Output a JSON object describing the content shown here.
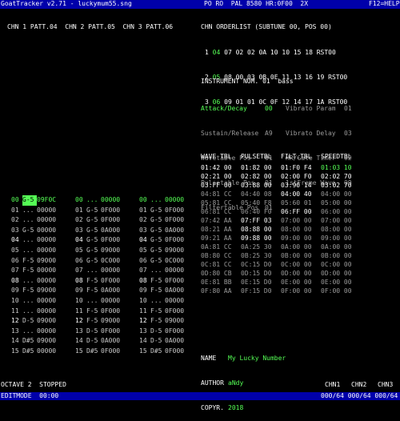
{
  "titlebar": {
    "left": "GoatTracker v2.71 - luckymum55.sng",
    "mid": "PO RO  PAL 8580 HR:0F00  2X",
    "right": "F12=HELP"
  },
  "channels_header": "CHN 1 PATT.04  CHN 2 PATT.05  CHN 3 PATT.06",
  "orderlist": {
    "title": "CHN ORDERLIST (SUBTUNE 00, POS 00)",
    "rows": [
      {
        "ch": "1",
        "first": "04",
        "rest": "07 02 02 0A 10 10 15 18 RST00"
      },
      {
        "ch": "2",
        "first": "05",
        "rest": "08 00 03 0B 0E 11 13 16 19 RST00"
      },
      {
        "ch": "3",
        "first": "06",
        "rest": "09 01 01 0C 0F 12 14 17 1A RST00"
      }
    ]
  },
  "instrument": {
    "title": "INSTRUMENT NUM. 01",
    "name": "bass",
    "params": [
      {
        "l": "Attack/Decay",
        "v": "00",
        "r": "Vibrato Param",
        "rv": "01"
      },
      {
        "l": "Sustain/Release",
        "v": "A9",
        "r": "Vibrato Delay",
        "rv": "03"
      },
      {
        "l": "Wavetable Pos",
        "v": "01",
        "r": "HR/Gate Timer",
        "rv": "02"
      },
      {
        "l": "Pulsetable Pos",
        "v": "01",
        "r": "1stFrame Wave",
        "rv": "09"
      },
      {
        "l": "Filtertable Pos",
        "v": "01",
        "r": "",
        "rv": ""
      }
    ]
  },
  "tables": {
    "headers": [
      "WAVE TBL",
      "PULSETBL",
      "FILT.TBL",
      "SPEEDTBL"
    ],
    "rows": [
      [
        "01:42 00",
        "01:82 00",
        "01:F0 F4",
        "01:03 10"
      ],
      [
        "02:21 00",
        "02:82 00",
        "02:00 F0",
        "02:02 70"
      ],
      [
        "03:FF 00",
        "03:88 00",
        "03:90 14",
        "03:02 70"
      ],
      [
        "04:81 CC",
        "04:40 08",
        "04:00 40",
        "04:00 00"
      ],
      [
        "05:81 CC",
        "05:40 F8",
        "05:60 01",
        "05:00 00"
      ],
      [
        "06:81 CC",
        "06:40 F0",
        "06:FF 00",
        "06:00 00"
      ],
      [
        "07:42 AA",
        "07:FF 03",
        "07:00 00",
        "07:00 00"
      ],
      [
        "08:21 AA",
        "08:88 00",
        "08:00 00",
        "08:00 00"
      ],
      [
        "09:21 AA",
        "09:88 00",
        "09:00 00",
        "09:00 00"
      ],
      [
        "0A:81 CC",
        "0A:25 30",
        "0A:00 00",
        "0A:00 00"
      ],
      [
        "0B:80 CC",
        "0B:25 30",
        "0B:00 00",
        "0B:00 00"
      ],
      [
        "0C:81 CC",
        "0C:15 D0",
        "0C:00 00",
        "0C:00 00"
      ],
      [
        "0D:80 CB",
        "0D:15 D0",
        "0D:00 00",
        "0D:00 00"
      ],
      [
        "0E:81 BB",
        "0E:15 D0",
        "0E:00 00",
        "0E:00 00"
      ],
      [
        "0F:80 AA",
        "0F:15 D0",
        "0F:00 00",
        "0F:00 00"
      ]
    ]
  },
  "song_info": {
    "name_label": "NAME",
    "name": "My Lucky Number",
    "author_label": "AUTHOR",
    "author": "aNdy",
    "copyr_label": "COPYR.",
    "copyr": "2018"
  },
  "patterns": [
    [
      "00",
      "G-5",
      "09F0C",
      "00",
      "...",
      "00000",
      "00",
      "...",
      "00000"
    ],
    [
      "01",
      "...",
      "00000",
      "01",
      "G-5",
      "0F000",
      "01",
      "G-5",
      "0F000"
    ],
    [
      "02",
      "...",
      "00000",
      "02",
      "G-5",
      "0F000",
      "02",
      "G-5",
      "0F000"
    ],
    [
      "03",
      "G-5",
      "00000",
      "03",
      "G-5",
      "0A000",
      "03",
      "G-5",
      "0A000"
    ],
    [
      "04",
      "...",
      "00000",
      "04",
      "G-5",
      "0F000",
      "04",
      "G-5",
      "0F000"
    ],
    [
      "05",
      "...",
      "00000",
      "05",
      "G-5",
      "09000",
      "05",
      "G-5",
      "09000"
    ],
    [
      "06",
      "F-5",
      "09000",
      "06",
      "G-5",
      "0C000",
      "06",
      "G-5",
      "0C000"
    ],
    [
      "07",
      "F-5",
      "00000",
      "07",
      "...",
      "00000",
      "07",
      "...",
      "00000"
    ],
    [
      "08",
      "...",
      "00000",
      "08",
      "F-5",
      "0F000",
      "08",
      "F-5",
      "0F000"
    ],
    [
      "09",
      "F-5",
      "09000",
      "09",
      "F-5",
      "0A000",
      "09",
      "F-5",
      "0A000"
    ],
    [
      "10",
      "...",
      "00000",
      "10",
      "...",
      "00000",
      "10",
      "...",
      "00000"
    ],
    [
      "11",
      "...",
      "00000",
      "11",
      "F-5",
      "0F000",
      "11",
      "F-5",
      "0F000"
    ],
    [
      "12",
      "D-5",
      "09000",
      "12",
      "F-5",
      "09000",
      "12",
      "F-5",
      "09000"
    ],
    [
      "13",
      "...",
      "00000",
      "13",
      "D-5",
      "0F000",
      "13",
      "D-5",
      "0F000"
    ],
    [
      "14",
      "D#5",
      "09000",
      "14",
      "D-5",
      "0A000",
      "14",
      "D-5",
      "0A000"
    ],
    [
      "15",
      "D#5",
      "00000",
      "15",
      "D#5",
      "0F000",
      "15",
      "D#5",
      "0F000"
    ]
  ],
  "status": {
    "octave": "OCTAVE 2  STOPPED",
    "editmode": "EDITMODE  00:00",
    "chn_labels": [
      "CHN1",
      "CHN2",
      "CHN3"
    ],
    "chn_pos": "000/64 000/64 000/64"
  }
}
